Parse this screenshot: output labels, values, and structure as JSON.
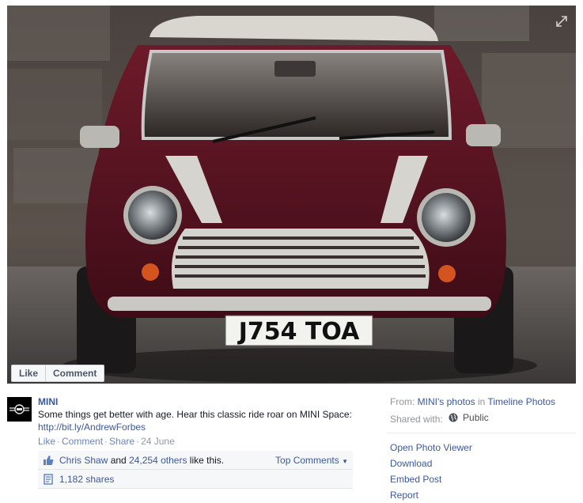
{
  "photo": {
    "plate_text": "J754 TOA",
    "actions": {
      "like_label": "Like",
      "comment_label": "Comment"
    }
  },
  "post": {
    "page_name": "MINI",
    "text": "Some things get better with age. Hear this classic ride roar on MINI Space:",
    "link": "http://bit.ly/AndrewForbes",
    "meta": {
      "like": "Like",
      "comment": "Comment",
      "share": "Share",
      "date": "24 June"
    },
    "likes": {
      "first_name": "Chris Shaw",
      "joiner": " and ",
      "others": "24,254 others",
      "suffix": " like this.",
      "top_comments": "Top Comments"
    },
    "shares": "1,182 shares"
  },
  "sidebar": {
    "from_label": "From: ",
    "from_link": "MINI's photos",
    "in_label": " in ",
    "album_link": "Timeline Photos",
    "shared_with_label": "Shared with:",
    "audience": "Public",
    "menu": [
      "Open Photo Viewer",
      "Download",
      "Embed Post",
      "Report"
    ]
  },
  "colors": {
    "link": "#3b5998",
    "car_body": "#5a1220",
    "text": "#141823"
  }
}
